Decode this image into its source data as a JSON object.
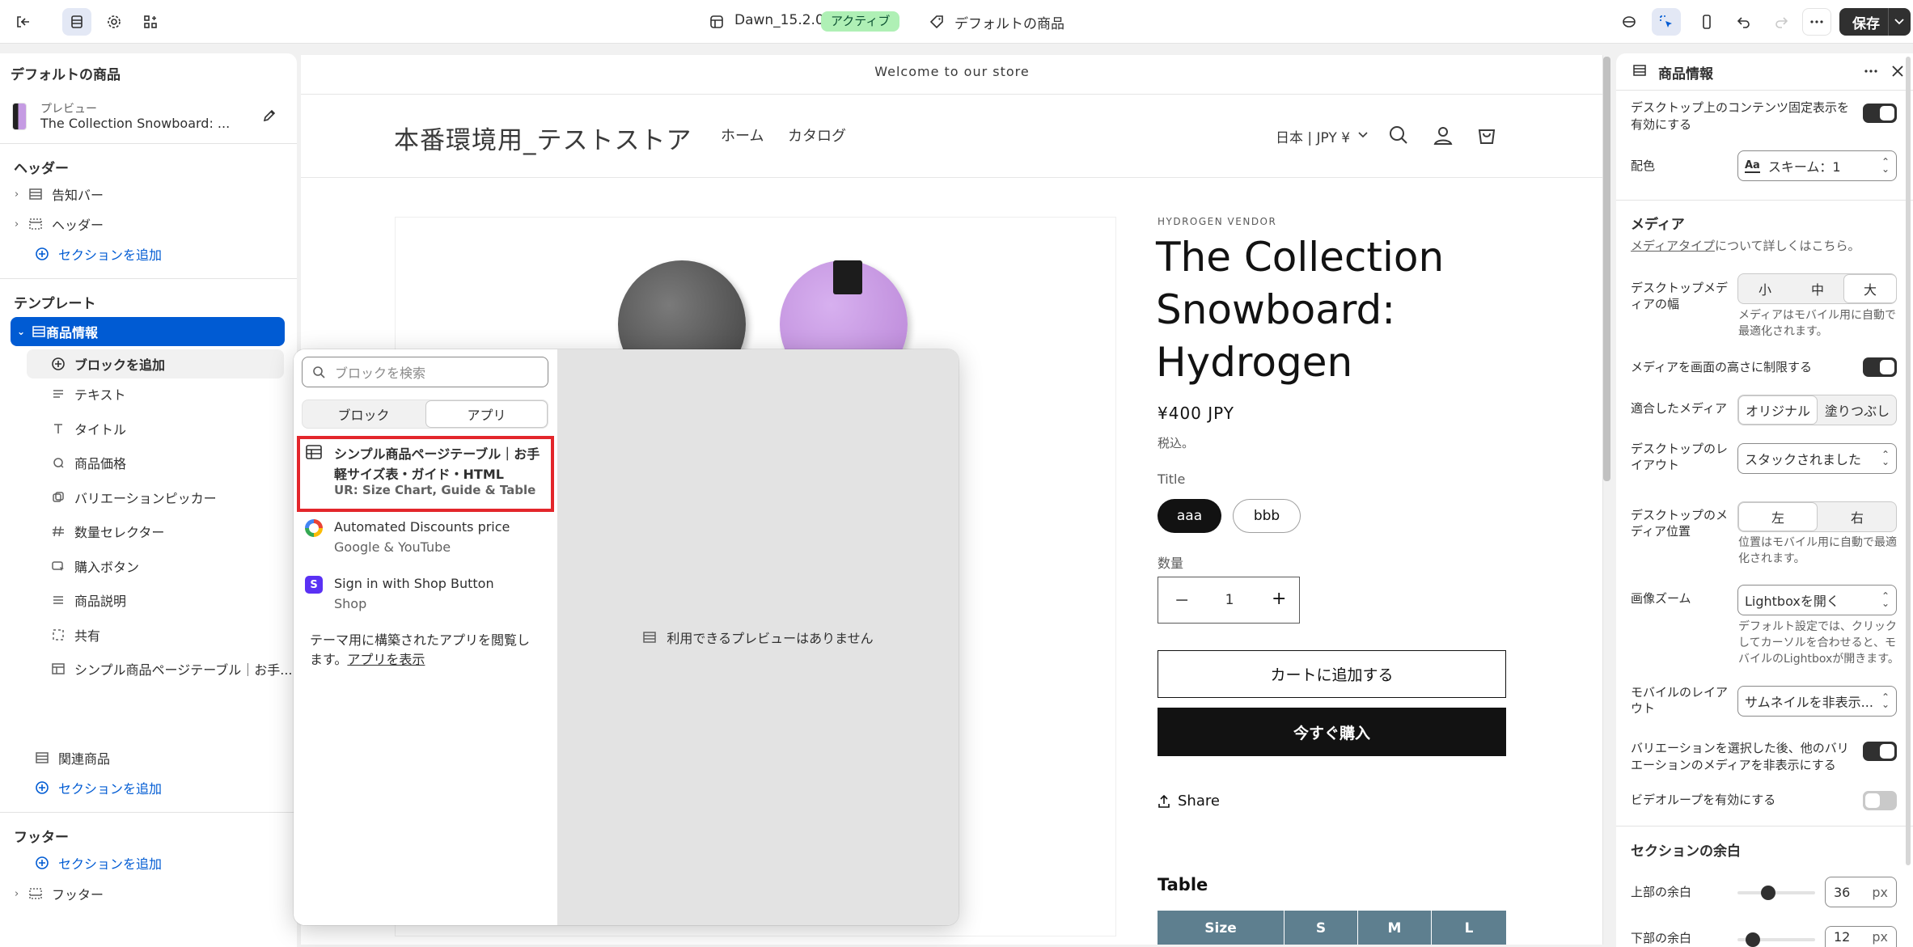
{
  "topbar": {
    "theme_name": "Dawn_15.2.0",
    "theme_status": "アクティブ",
    "template_name": "デフォルトの商品",
    "save_label": "保存"
  },
  "left": {
    "title": "デフォルトの商品",
    "preview_label": "プレビュー",
    "preview_product": "The Collection Snowboard: ...",
    "header_group": "ヘッダー",
    "header_items": [
      {
        "label": "告知バー",
        "icon": "section-icon"
      },
      {
        "label": "ヘッダー",
        "icon": "header-section-icon"
      }
    ],
    "add_section": "セクションを追加",
    "template_group": "テンプレート",
    "selected_section": "商品情報",
    "add_block": "ブロックを追加",
    "blocks": [
      {
        "label": "テキスト",
        "icon": "text-icon"
      },
      {
        "label": "タイトル",
        "icon": "title-icon"
      },
      {
        "label": "商品価格",
        "icon": "price-icon"
      },
      {
        "label": "バリエーションピッカー",
        "icon": "variant-picker-icon"
      },
      {
        "label": "数量セレクター",
        "icon": "quantity-icon"
      },
      {
        "label": "購入ボタン",
        "icon": "buy-button-icon"
      },
      {
        "label": "商品説明",
        "icon": "description-icon"
      },
      {
        "label": "共有",
        "icon": "share-icon"
      },
      {
        "label": "シンプル商品ページテーブル｜お手...",
        "icon": "table-icon"
      }
    ],
    "related_section": "関連商品",
    "footer_group": "フッター",
    "footer_item": "フッター"
  },
  "preview": {
    "announcement": "Welcome to our store",
    "store_name": "本番環境用_テストストア",
    "nav": [
      "ホーム",
      "カタログ"
    ],
    "locale": "日本 | JPY ¥",
    "vendor": "HYDROGEN VENDOR",
    "product_title_lines": [
      "The Collection",
      "Snowboard:",
      "Hydrogen"
    ],
    "price": "¥400 JPY",
    "tax_note": "税込。",
    "option_label": "Title",
    "options": [
      "aaa",
      "bbb"
    ],
    "quantity_label": "数量",
    "quantity": "1",
    "add_to_cart": "カートに追加する",
    "buy_now": "今すぐ購入",
    "share": "Share",
    "table_heading": "Table",
    "table_columns": [
      "Size",
      "S",
      "M",
      "L"
    ]
  },
  "popup": {
    "search_placeholder": "ブロックを検索",
    "tabs": [
      "ブロック",
      "アプリ"
    ],
    "apps": [
      {
        "title_line1": "シンプル商品ページテーブル｜お手",
        "title_line2": "軽サイズ表・ガイド・HTML",
        "sub": "UR: Size Chart, Guide & Table",
        "icon": "table-app-icon"
      },
      {
        "title_line1": "Automated Discounts price",
        "sub": "Google & YouTube",
        "icon": "google-icon"
      },
      {
        "title_line1": "Sign in with Shop Button",
        "sub": "Shop",
        "icon": "shop-icon"
      }
    ],
    "browse_text_1": "テーマ用に構築されたアプリを閲覧し",
    "browse_text_2": "ます。",
    "browse_link": "アプリを表示",
    "no_preview": "利用できるプレビューはありません"
  },
  "inspector": {
    "title": "商品情報",
    "sticky_label_1": "デスクトップ上のコンテンツ固定表示を",
    "sticky_label_2": "有効にする",
    "color_label": "配色",
    "color_value": "スキーム：1",
    "media_section": "メディア",
    "media_link": "メディアタイプ",
    "media_link_rest": "について詳しくはこちら。",
    "media_width_label_1": "デスクトップメデ",
    "media_width_label_2": "ィアの幅",
    "media_width_options": [
      "小",
      "中",
      "大"
    ],
    "media_width_selected": "大",
    "media_width_help_1": "メディアはモバイル用に自動で",
    "media_width_help_2": "最適化されます。",
    "constrain_label": "メディアを画面の高さに制限する",
    "fit_label": "適合したメディア",
    "fit_options": [
      "オリジナル",
      "塗りつぶし"
    ],
    "fit_selected": "オリジナル",
    "layout_label_1": "デスクトップのレ",
    "layout_label_2": "イアウト",
    "layout_value": "スタックされました",
    "position_label_1": "デスクトップのメ",
    "position_label_2": "ディア位置",
    "position_options": [
      "左",
      "右"
    ],
    "position_selected": "左",
    "position_help_1": "位置はモバイル用に自動で最適",
    "position_help_2": "化されます。",
    "zoom_label": "画像ズーム",
    "zoom_value": "Lightboxを開く",
    "zoom_help_1": "デフォルト設定では、クリック",
    "zoom_help_2": "してカーソルを合わせると、モ",
    "zoom_help_3": "バイルのLightboxが開きます。",
    "mobile_layout_label_1": "モバイルのレイア",
    "mobile_layout_label_2": "ウト",
    "mobile_layout_value": "サムネイルを非表示...",
    "hide_variants_label_1": "バリエーションを選択した後、他のバリ",
    "hide_variants_label_2": "エーションのメディアを非表示にする",
    "video_loop_label": "ビデオループを有効にする",
    "padding_section": "セクションの余白",
    "top_padding_label": "上部の余白",
    "top_padding_value": "36",
    "bottom_padding_label": "下部の余白",
    "bottom_padding_value": "12",
    "unit": "px",
    "toggles": {
      "sticky": true,
      "constrain": true,
      "hide_variants": true,
      "video_loop": false
    }
  }
}
